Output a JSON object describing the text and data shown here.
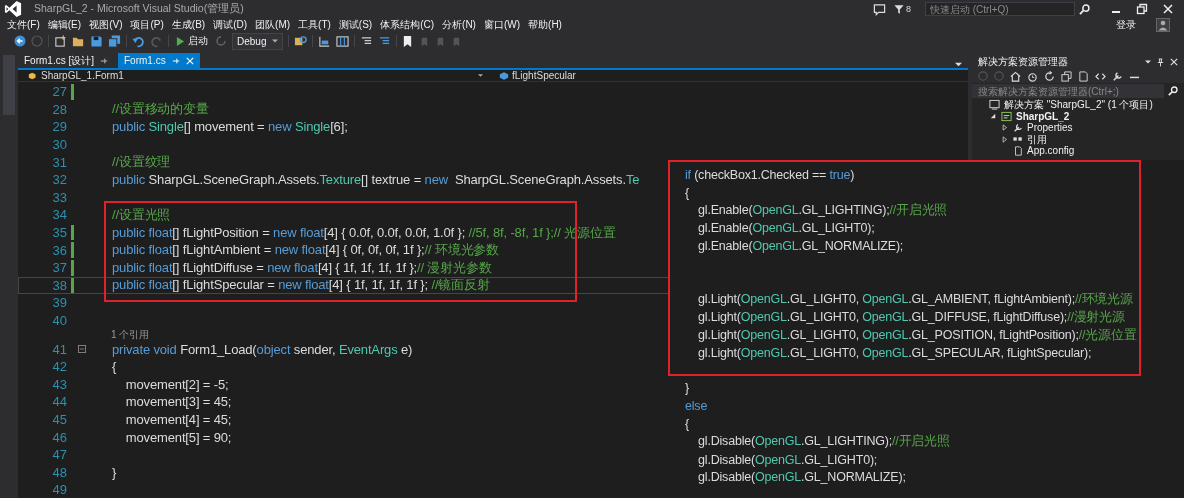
{
  "window": {
    "title": "SharpGL_2 - Microsoft Visual Studio(管理员)",
    "notification_count": "8",
    "quick_launch": {
      "placeholder": "快速启动 (Ctrl+Q)"
    },
    "sign_in": "登录"
  },
  "menu": [
    "文件(F)",
    "编辑(E)",
    "视图(V)",
    "项目(P)",
    "生成(B)",
    "调试(D)",
    "团队(M)",
    "工具(T)",
    "测试(S)",
    "体系结构(C)",
    "分析(N)",
    "窗口(W)",
    "帮助(H)"
  ],
  "toolbar": {
    "start_label": "启动",
    "configuration": "Debug"
  },
  "tabs": [
    {
      "label": "Form1.cs [设计]",
      "selected": false
    },
    {
      "label": "Form1.cs",
      "selected": true
    }
  ],
  "nav_bar": {
    "type": "SharpGL_1.Form1",
    "member": "fLightSpecular"
  },
  "editor": {
    "lines": [
      {
        "number": "27",
        "changed": true,
        "current": false
      },
      {
        "number": "28",
        "changed": false,
        "current": false,
        "tokens": [
          {
            "kind": "comment",
            "text": "//设置移动的变量"
          }
        ]
      },
      {
        "number": "29",
        "changed": false,
        "current": false,
        "tokens": [
          {
            "kind": "keyword",
            "text": "public "
          },
          {
            "kind": "type",
            "text": "Single"
          },
          {
            "kind": "plain",
            "text": "[] movement = "
          },
          {
            "kind": "keyword",
            "text": "new "
          },
          {
            "kind": "type",
            "text": "Single"
          },
          {
            "kind": "plain",
            "text": "[6];"
          }
        ]
      },
      {
        "number": "30",
        "changed": false,
        "current": false
      },
      {
        "number": "31",
        "changed": false,
        "current": false,
        "tokens": [
          {
            "kind": "comment",
            "text": "//设置纹理"
          }
        ]
      },
      {
        "number": "32",
        "changed": false,
        "current": false,
        "tokens": [
          {
            "kind": "keyword",
            "text": "public "
          },
          {
            "kind": "plain",
            "text": "SharpGL.SceneGraph.Assets."
          },
          {
            "kind": "type",
            "text": "Texture"
          },
          {
            "kind": "plain",
            "text": "[] textrue = "
          },
          {
            "kind": "keyword",
            "text": "new "
          },
          {
            "kind": "plain",
            "text": " SharpGL.SceneGraph.Assets."
          },
          {
            "kind": "type",
            "text": "Te"
          }
        ]
      },
      {
        "number": "33",
        "changed": false,
        "current": false
      },
      {
        "number": "34",
        "changed": false,
        "current": false,
        "tokens": [
          {
            "kind": "comment",
            "text": "//设置光照"
          }
        ]
      },
      {
        "number": "35",
        "changed": true,
        "current": false,
        "tokens": [
          {
            "kind": "keyword",
            "text": "public "
          },
          {
            "kind": "keyword",
            "text": "float"
          },
          {
            "kind": "plain",
            "text": "[] fLightPosition = "
          },
          {
            "kind": "keyword",
            "text": "new "
          },
          {
            "kind": "keyword",
            "text": "float"
          },
          {
            "kind": "plain",
            "text": "[4] { 0.0f, 0.0f, 0.0f, 1.0f }; "
          },
          {
            "kind": "comment",
            "text": "//5f, 8f, -8f, 1f };// 光源位置"
          }
        ]
      },
      {
        "number": "36",
        "changed": true,
        "current": false,
        "tokens": [
          {
            "kind": "keyword",
            "text": "public "
          },
          {
            "kind": "keyword",
            "text": "float"
          },
          {
            "kind": "plain",
            "text": "[] fLightAmbient = "
          },
          {
            "kind": "keyword",
            "text": "new "
          },
          {
            "kind": "keyword",
            "text": "float"
          },
          {
            "kind": "plain",
            "text": "[4] { 0f, 0f, 0f, 1f };"
          },
          {
            "kind": "comment",
            "text": "// 环境光参数"
          }
        ]
      },
      {
        "number": "37",
        "changed": true,
        "current": false,
        "tokens": [
          {
            "kind": "keyword",
            "text": "public "
          },
          {
            "kind": "keyword",
            "text": "float"
          },
          {
            "kind": "plain",
            "text": "[] fLightDiffuse = "
          },
          {
            "kind": "keyword",
            "text": "new "
          },
          {
            "kind": "keyword",
            "text": "float"
          },
          {
            "kind": "plain",
            "text": "[4] { 1f, 1f, 1f, 1f };"
          },
          {
            "kind": "comment",
            "text": "// 漫射光参数"
          }
        ]
      },
      {
        "number": "38",
        "changed": true,
        "current": true,
        "tokens": [
          {
            "kind": "keyword",
            "text": "public "
          },
          {
            "kind": "keyword",
            "text": "float"
          },
          {
            "kind": "plain",
            "text": "[] fLightSpecular = "
          },
          {
            "kind": "keyword",
            "text": "new "
          },
          {
            "kind": "keyword",
            "text": "float"
          },
          {
            "kind": "plain",
            "text": "[4] { 1f, 1f, 1f, 1f }; "
          },
          {
            "kind": "comment",
            "text": "//镜面反射"
          }
        ]
      },
      {
        "number": "39",
        "changed": false,
        "current": false
      },
      {
        "number": "40",
        "changed": false,
        "current": false
      },
      {
        "number": "41",
        "changed": false,
        "current": false,
        "codelens": "1 个引用",
        "foldable": true,
        "tokens": [
          {
            "kind": "keyword",
            "text": "private "
          },
          {
            "kind": "keyword",
            "text": "void "
          },
          {
            "kind": "plain",
            "text": "Form1_Load("
          },
          {
            "kind": "keyword",
            "text": "object "
          },
          {
            "kind": "plain",
            "text": "sender, "
          },
          {
            "kind": "type",
            "text": "EventArgs"
          },
          {
            "kind": "plain",
            "text": " e)"
          }
        ]
      },
      {
        "number": "42",
        "changed": false,
        "current": false,
        "tokens": [
          {
            "kind": "plain",
            "text": "{"
          }
        ]
      },
      {
        "number": "43",
        "changed": false,
        "current": false,
        "tokens": [
          {
            "kind": "plain",
            "text": "    movement[2] = -5;"
          }
        ]
      },
      {
        "number": "44",
        "changed": false,
        "current": false,
        "tokens": [
          {
            "kind": "plain",
            "text": "    movement[3] = 45;"
          }
        ]
      },
      {
        "number": "45",
        "changed": false,
        "current": false,
        "tokens": [
          {
            "kind": "plain",
            "text": "    movement[4] = 45;"
          }
        ]
      },
      {
        "number": "46",
        "changed": false,
        "current": false,
        "tokens": [
          {
            "kind": "plain",
            "text": "    movement[5] = 90;"
          }
        ]
      },
      {
        "number": "47",
        "changed": false,
        "current": false
      },
      {
        "number": "48",
        "changed": false,
        "current": false,
        "tokens": [
          {
            "kind": "plain",
            "text": "}"
          }
        ]
      },
      {
        "number": "49",
        "changed": false,
        "current": false
      }
    ]
  },
  "solution_explorer": {
    "title": "解决方案资源管理器",
    "search": {
      "placeholder": "搜索解决方案资源管理器(Ctrl+;)"
    },
    "tree": [
      {
        "label": "解决方案 \"SharpGL_2\" (1 个项目)",
        "kind": "solution",
        "children": [
          {
            "label": "SharpGL_2",
            "kind": "project",
            "expanded": true,
            "children": [
              {
                "label": "Properties",
                "kind": "properties",
                "expanded": false
              },
              {
                "label": "引用",
                "kind": "references",
                "expanded": false
              },
              {
                "label": "App.config",
                "kind": "file"
              }
            ]
          }
        ]
      }
    ]
  },
  "snippet": {
    "lines": [
      {
        "kind": "code",
        "tokens": [
          {
            "kind": "keyword",
            "text": "if"
          },
          {
            "kind": "plain",
            "text": " (checkBox1.Checked == "
          },
          {
            "kind": "keyword",
            "text": "true"
          },
          {
            "kind": "plain",
            "text": ")"
          }
        ]
      },
      {
        "kind": "code",
        "tokens": [
          {
            "kind": "plain",
            "text": "{"
          }
        ]
      },
      {
        "kind": "code",
        "tokens": [
          {
            "kind": "plain",
            "text": "    gl.Enable("
          },
          {
            "kind": "type",
            "text": "OpenGL"
          },
          {
            "kind": "plain",
            "text": ".GL_LIGHTING);"
          },
          {
            "kind": "comment",
            "text": "//开启光照"
          }
        ]
      },
      {
        "kind": "code",
        "tokens": [
          {
            "kind": "plain",
            "text": "    gl.Enable("
          },
          {
            "kind": "type",
            "text": "OpenGL"
          },
          {
            "kind": "plain",
            "text": ".GL_LIGHT0);"
          }
        ]
      },
      {
        "kind": "code",
        "tokens": [
          {
            "kind": "plain",
            "text": "    gl.Enable("
          },
          {
            "kind": "type",
            "text": "OpenGL"
          },
          {
            "kind": "plain",
            "text": ".GL_NORMALIZE);"
          }
        ]
      },
      {
        "kind": "blank"
      },
      {
        "kind": "blank"
      },
      {
        "kind": "code",
        "tokens": [
          {
            "kind": "plain",
            "text": "    gl.Light("
          },
          {
            "kind": "type",
            "text": "OpenGL"
          },
          {
            "kind": "plain",
            "text": ".GL_LIGHT0, "
          },
          {
            "kind": "type",
            "text": "OpenGL"
          },
          {
            "kind": "plain",
            "text": ".GL_AMBIENT, fLightAmbient);"
          },
          {
            "kind": "comment",
            "text": "//环境光源"
          }
        ]
      },
      {
        "kind": "code",
        "tokens": [
          {
            "kind": "plain",
            "text": "    gl.Light("
          },
          {
            "kind": "type",
            "text": "OpenGL"
          },
          {
            "kind": "plain",
            "text": ".GL_LIGHT0, "
          },
          {
            "kind": "type",
            "text": "OpenGL"
          },
          {
            "kind": "plain",
            "text": ".GL_DIFFUSE, fLightDiffuse);"
          },
          {
            "kind": "comment",
            "text": "//漫射光源"
          }
        ]
      },
      {
        "kind": "code",
        "tokens": [
          {
            "kind": "plain",
            "text": "    gl.Light("
          },
          {
            "kind": "type",
            "text": "OpenGL"
          },
          {
            "kind": "plain",
            "text": ".GL_LIGHT0, "
          },
          {
            "kind": "type",
            "text": "OpenGL"
          },
          {
            "kind": "plain",
            "text": ".GL_POSITION, fLightPosition);"
          },
          {
            "kind": "comment",
            "text": "//光源位置"
          }
        ]
      },
      {
        "kind": "code",
        "tokens": [
          {
            "kind": "plain",
            "text": "    gl.Light("
          },
          {
            "kind": "type",
            "text": "OpenGL"
          },
          {
            "kind": "plain",
            "text": ".GL_LIGHT0, "
          },
          {
            "kind": "type",
            "text": "OpenGL"
          },
          {
            "kind": "plain",
            "text": ".GL_SPECULAR, fLightSpecular);"
          }
        ]
      },
      {
        "kind": "blank"
      },
      {
        "kind": "code",
        "tokens": [
          {
            "kind": "plain",
            "text": "}"
          }
        ]
      },
      {
        "kind": "code",
        "tokens": [
          {
            "kind": "keyword",
            "text": "else"
          }
        ]
      },
      {
        "kind": "code",
        "tokens": [
          {
            "kind": "plain",
            "text": "{"
          }
        ]
      },
      {
        "kind": "code",
        "tokens": [
          {
            "kind": "plain",
            "text": "    gl.Disable("
          },
          {
            "kind": "type",
            "text": "OpenGL"
          },
          {
            "kind": "plain",
            "text": ".GL_LIGHTING);"
          },
          {
            "kind": "comment",
            "text": "//开启光照"
          }
        ]
      },
      {
        "kind": "code",
        "tokens": [
          {
            "kind": "plain",
            "text": "    gl.Disable("
          },
          {
            "kind": "type",
            "text": "OpenGL"
          },
          {
            "kind": "plain",
            "text": ".GL_LIGHT0);"
          }
        ]
      },
      {
        "kind": "code",
        "tokens": [
          {
            "kind": "plain",
            "text": "    gl.Disable("
          },
          {
            "kind": "type",
            "text": "OpenGL"
          },
          {
            "kind": "plain",
            "text": ".GL_NORMALIZE);"
          }
        ]
      }
    ]
  }
}
